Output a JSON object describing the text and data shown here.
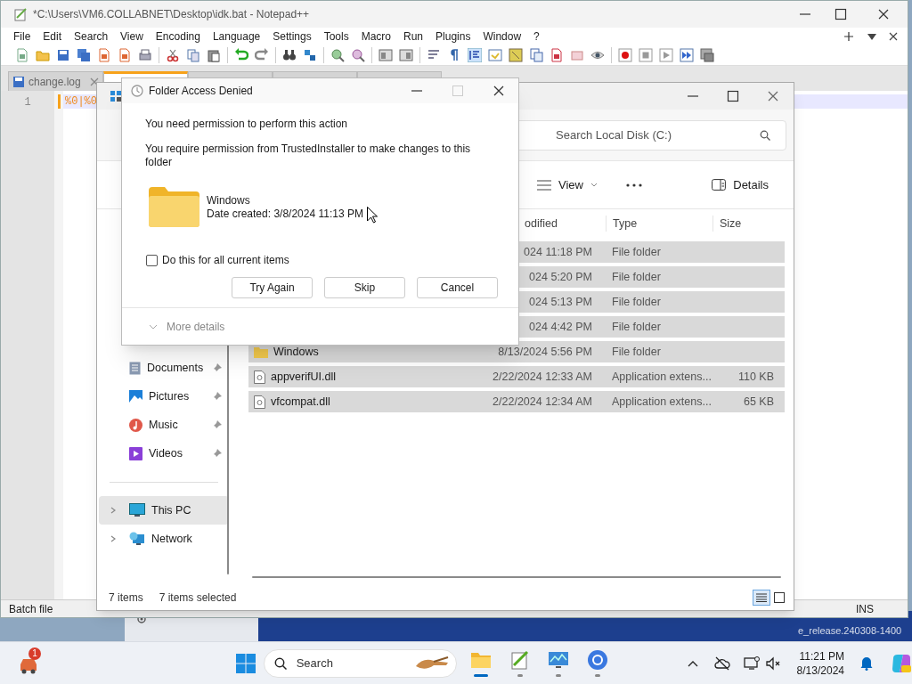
{
  "notepad": {
    "title": "*C:\\Users\\VM6.COLLABNET\\Desktop\\idk.bat - Notepad++",
    "menu": [
      "File",
      "Edit",
      "Search",
      "View",
      "Encoding",
      "Language",
      "Settings",
      "Tools",
      "Macro",
      "Run",
      "Plugins",
      "Window",
      "?"
    ],
    "tabs": [
      {
        "label": "change.log",
        "selected": false
      },
      {
        "selected": true
      },
      {
        "selected": false
      },
      {
        "selected": false
      },
      {
        "selected": false
      }
    ],
    "editor": {
      "line_number": "1",
      "line_text": "%0|%0"
    },
    "status_bar": {
      "file_type": "Batch file",
      "mode": "INS"
    }
  },
  "explorer": {
    "search": {
      "placeholder": "Search Local Disk (C:)"
    },
    "toolbar": {
      "view": "View",
      "details": "Details"
    },
    "columns": [
      "odified",
      "Type",
      "Size"
    ],
    "rows": [
      {
        "date": "024 11:18 PM",
        "type": "File folder",
        "selected": true
      },
      {
        "date": "024 5:20 PM",
        "type": "File folder",
        "selected": true
      },
      {
        "date": "024 5:13 PM",
        "type": "File folder",
        "selected": true
      },
      {
        "date": "024 4:42 PM",
        "type": "File folder",
        "selected": true
      },
      {
        "kind": "folder",
        "name": "Windows",
        "date": "8/13/2024 5:56 PM",
        "type": "File folder",
        "selected": true
      },
      {
        "kind": "file",
        "name": "appverifUI.dll",
        "date": "2/22/2024 12:33 AM",
        "type": "Application extens...",
        "size": "110 KB",
        "selected": true
      },
      {
        "kind": "file",
        "name": "vfcompat.dll",
        "date": "2/22/2024 12:34 AM",
        "type": "Application extens...",
        "size": "65 KB",
        "selected": true
      }
    ],
    "nav_quick": [
      {
        "kind": "documents",
        "label": "Documents",
        "pinned": true,
        "selected": false
      },
      {
        "kind": "pictures",
        "label": "Pictures",
        "pinned": true,
        "selected": false
      },
      {
        "kind": "music",
        "label": "Music",
        "pinned": true,
        "selected": false
      },
      {
        "kind": "videos",
        "label": "Videos",
        "pinned": true,
        "selected": false
      }
    ],
    "nav_tree": [
      {
        "kind": "pc",
        "label": "This PC",
        "expanded": false,
        "selected": true
      },
      {
        "kind": "network",
        "label": "Network",
        "expanded": false,
        "selected": false
      }
    ],
    "status_bar": {
      "count": "7 items",
      "selection": "7 items selected"
    }
  },
  "dialog": {
    "title": "Folder Access Denied",
    "heading": "You need permission to perform this action",
    "message": "You require permission from TrustedInstaller to make changes to this folder",
    "item_name": "Windows",
    "item_date": "Date created: 3/8/2024 11:13 PM",
    "checkbox": {
      "label": "Do this for all current items",
      "checked": false
    },
    "buttons": [
      "Try Again",
      "Skip",
      "Cancel"
    ],
    "more_details": "More details"
  },
  "desktop": {
    "build": "e_release.240308-1400"
  },
  "taskbar": {
    "widget_badge": "1",
    "placeholder": "Search",
    "time": "11:21 PM",
    "date": "8/13/2024"
  }
}
